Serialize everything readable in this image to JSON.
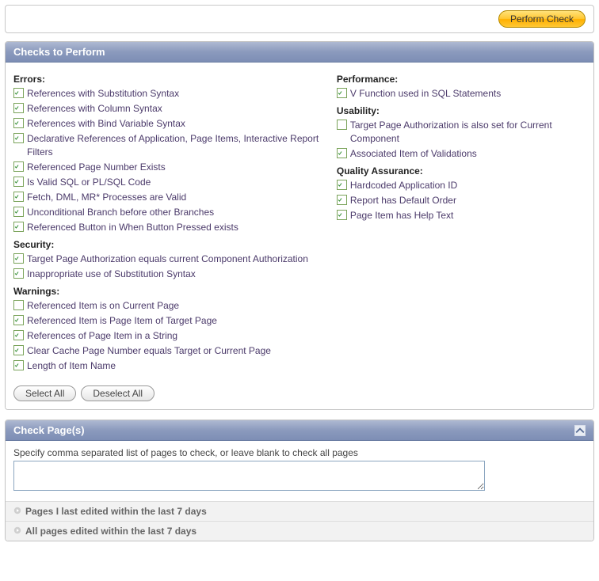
{
  "top": {
    "perform_check": "Perform Check"
  },
  "region_checks": {
    "title": "Checks to Perform",
    "groups": {
      "errors": {
        "title": "Errors:",
        "items": [
          {
            "label": "References with Substitution Syntax",
            "checked": true
          },
          {
            "label": "References with Column Syntax",
            "checked": true
          },
          {
            "label": "References with Bind Variable Syntax",
            "checked": true
          },
          {
            "label": "Declarative References of Application, Page Items, Interactive Report Filters",
            "checked": true
          },
          {
            "label": "Referenced Page Number Exists",
            "checked": true
          },
          {
            "label": "Is Valid SQL or PL/SQL Code",
            "checked": true
          },
          {
            "label": "Fetch, DML, MR* Processes are Valid",
            "checked": true
          },
          {
            "label": "Unconditional Branch before other Branches",
            "checked": true
          },
          {
            "label": "Referenced Button in When Button Pressed exists",
            "checked": true
          }
        ]
      },
      "security": {
        "title": "Security:",
        "items": [
          {
            "label": "Target Page Authorization equals current Component Authorization",
            "checked": true
          },
          {
            "label": "Inappropriate use of Substitution Syntax",
            "checked": true
          }
        ]
      },
      "warnings": {
        "title": "Warnings:",
        "items": [
          {
            "label": "Referenced Item is on Current Page",
            "checked": false
          },
          {
            "label": "Referenced Item is Page Item of Target Page",
            "checked": true
          },
          {
            "label": "References of Page Item in a String",
            "checked": true
          },
          {
            "label": "Clear Cache Page Number equals Target or Current Page",
            "checked": true
          },
          {
            "label": "Length of Item Name",
            "checked": true
          }
        ]
      },
      "performance": {
        "title": "Performance:",
        "items": [
          {
            "label": "V Function used in SQL Statements",
            "checked": true
          }
        ]
      },
      "usability": {
        "title": "Usability:",
        "items": [
          {
            "label": "Target Page Authorization is also set for Current Component",
            "checked": false
          },
          {
            "label": "Associated Item of Validations",
            "checked": true
          }
        ]
      },
      "qa": {
        "title": "Quality Assurance:",
        "items": [
          {
            "label": "Hardcoded Application ID",
            "checked": true
          },
          {
            "label": "Report has Default Order",
            "checked": true
          },
          {
            "label": "Page Item has Help Text",
            "checked": true
          }
        ]
      }
    },
    "buttons": {
      "select_all": "Select All",
      "deselect_all": "Deselect All"
    }
  },
  "region_pages": {
    "title": "Check Page(s)",
    "instruction": "Specify comma separated list of pages to check, or leave blank to check all pages",
    "textarea_value": "",
    "expanders": [
      "Pages I last edited within the last 7 days",
      "All pages edited within the last 7 days"
    ]
  }
}
